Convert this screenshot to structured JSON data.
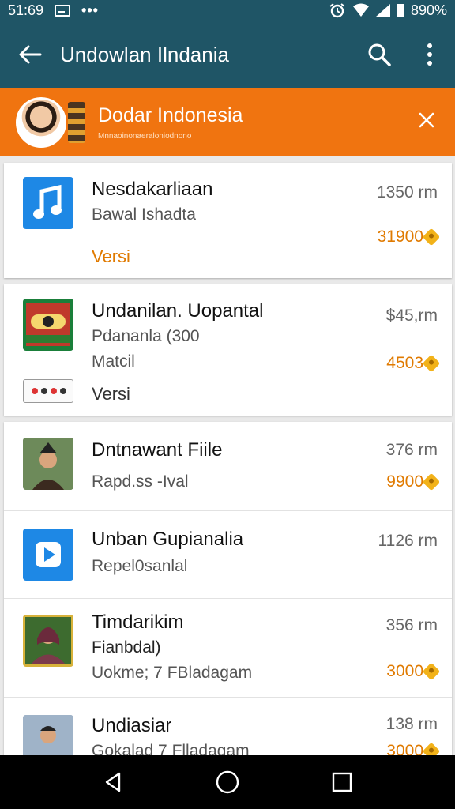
{
  "status_bar": {
    "time": "51:69",
    "notif_icons": [
      "image-notification-icon",
      "more-notifications-icon"
    ],
    "battery": "890%",
    "icons": [
      "alarm-icon",
      "wifi-icon",
      "signal-icon",
      "battery-icon"
    ]
  },
  "app_bar": {
    "title": "Undowlan Ilndania",
    "back_icon": "back-arrow-icon",
    "search_icon": "search-icon",
    "menu_icon": "more-vert-icon"
  },
  "promo": {
    "title": "Dodar Indonesia",
    "subtitle": "Mnnaoinonaeraloniodnono",
    "close_icon": "close-icon",
    "colors": {
      "background": "#f07410"
    }
  },
  "items": [
    {
      "name": "Nesdakarliaan",
      "lines": [
        "Bawal Ishadta"
      ],
      "size": "1350 rm",
      "price": "31900",
      "versi": "Versi",
      "versi_color": "#e07a00",
      "icon": "music-note-icon"
    },
    {
      "name": "Undanilan. Uopantal",
      "lines": [
        "Pdananla (300",
        "Matcil"
      ],
      "size": "$45,rm",
      "price": "4503",
      "versi": "Versi",
      "versi_color": "#333333",
      "icon": "game-logo-icon"
    },
    {
      "name": "Dntnawant Fiile",
      "lines": [
        "Rapd.ss -Ival"
      ],
      "size": "376 rm",
      "price": "9900",
      "icon": "person-photo-icon"
    },
    {
      "name": "Unban Gupianalia",
      "lines": [
        "Repel0sanlal"
      ],
      "size": "1126 rm",
      "price": "",
      "icon": "play-icon"
    },
    {
      "name": "Timdarikim",
      "lines": [
        "Fianbdal)",
        "Uokme; 7 FBladagam"
      ],
      "size": "356 rm",
      "price": "3000",
      "icon": "person-photo-icon"
    },
    {
      "name": "Undiasiar",
      "lines": [
        "Gokalad 7 Flladagam"
      ],
      "size": "138 rm",
      "price": "3000",
      "icon": "person-photo-icon"
    }
  ],
  "nav_bar": {
    "back_icon": "nav-back-icon",
    "home_icon": "nav-home-icon",
    "recents_icon": "nav-recents-icon"
  }
}
